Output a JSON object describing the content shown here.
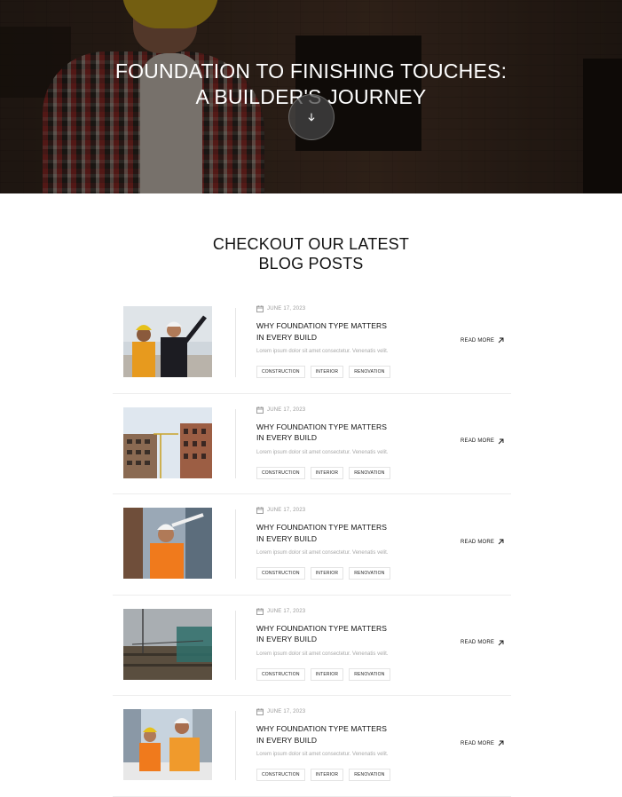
{
  "hero": {
    "title": "FOUNDATION TO FINISHING TOUCHES:\nA BUILDER'S JOURNEY",
    "scroll_icon": "arrow-down-icon"
  },
  "blog": {
    "heading": "CHECKOUT OUR LATEST\nBLOG POSTS",
    "posts": [
      {
        "date": "JUNE 17, 2023",
        "title": "WHY FOUNDATION TYPE MATTERS\nIN EVERY BUILD",
        "excerpt": "Lorem ipsum dolor sit amet consectetur. Venenatis velit.",
        "tags": [
          "CONSTRUCTION",
          "INTERIOR",
          "RENOVATION"
        ],
        "read_more": "READ MORE"
      },
      {
        "date": "JUNE 17, 2023",
        "title": "WHY FOUNDATION TYPE MATTERS\nIN EVERY BUILD",
        "excerpt": "Lorem ipsum dolor sit amet consectetur. Venenatis velit.",
        "tags": [
          "CONSTRUCTION",
          "INTERIOR",
          "RENOVATION"
        ],
        "read_more": "READ MORE"
      },
      {
        "date": "JUNE 17, 2023",
        "title": "WHY FOUNDATION TYPE MATTERS\nIN EVERY BUILD",
        "excerpt": "Lorem ipsum dolor sit amet consectetur. Venenatis velit.",
        "tags": [
          "CONSTRUCTION",
          "INTERIOR",
          "RENOVATION"
        ],
        "read_more": "READ MORE"
      },
      {
        "date": "JUNE 17, 2023",
        "title": "WHY FOUNDATION TYPE MATTERS\nIN EVERY BUILD",
        "excerpt": "Lorem ipsum dolor sit amet consectetur. Venenatis velit.",
        "tags": [
          "CONSTRUCTION",
          "INTERIOR",
          "RENOVATION"
        ],
        "read_more": "READ MORE"
      },
      {
        "date": "JUNE 17, 2023",
        "title": "WHY FOUNDATION TYPE MATTERS\nIN EVERY BUILD",
        "excerpt": "Lorem ipsum dolor sit amet consectetur. Venenatis velit.",
        "tags": [
          "CONSTRUCTION",
          "INTERIOR",
          "RENOVATION"
        ],
        "read_more": "READ MORE"
      }
    ]
  },
  "icons": {
    "date": "calendar-icon",
    "read_more": "arrow-up-right-icon"
  }
}
